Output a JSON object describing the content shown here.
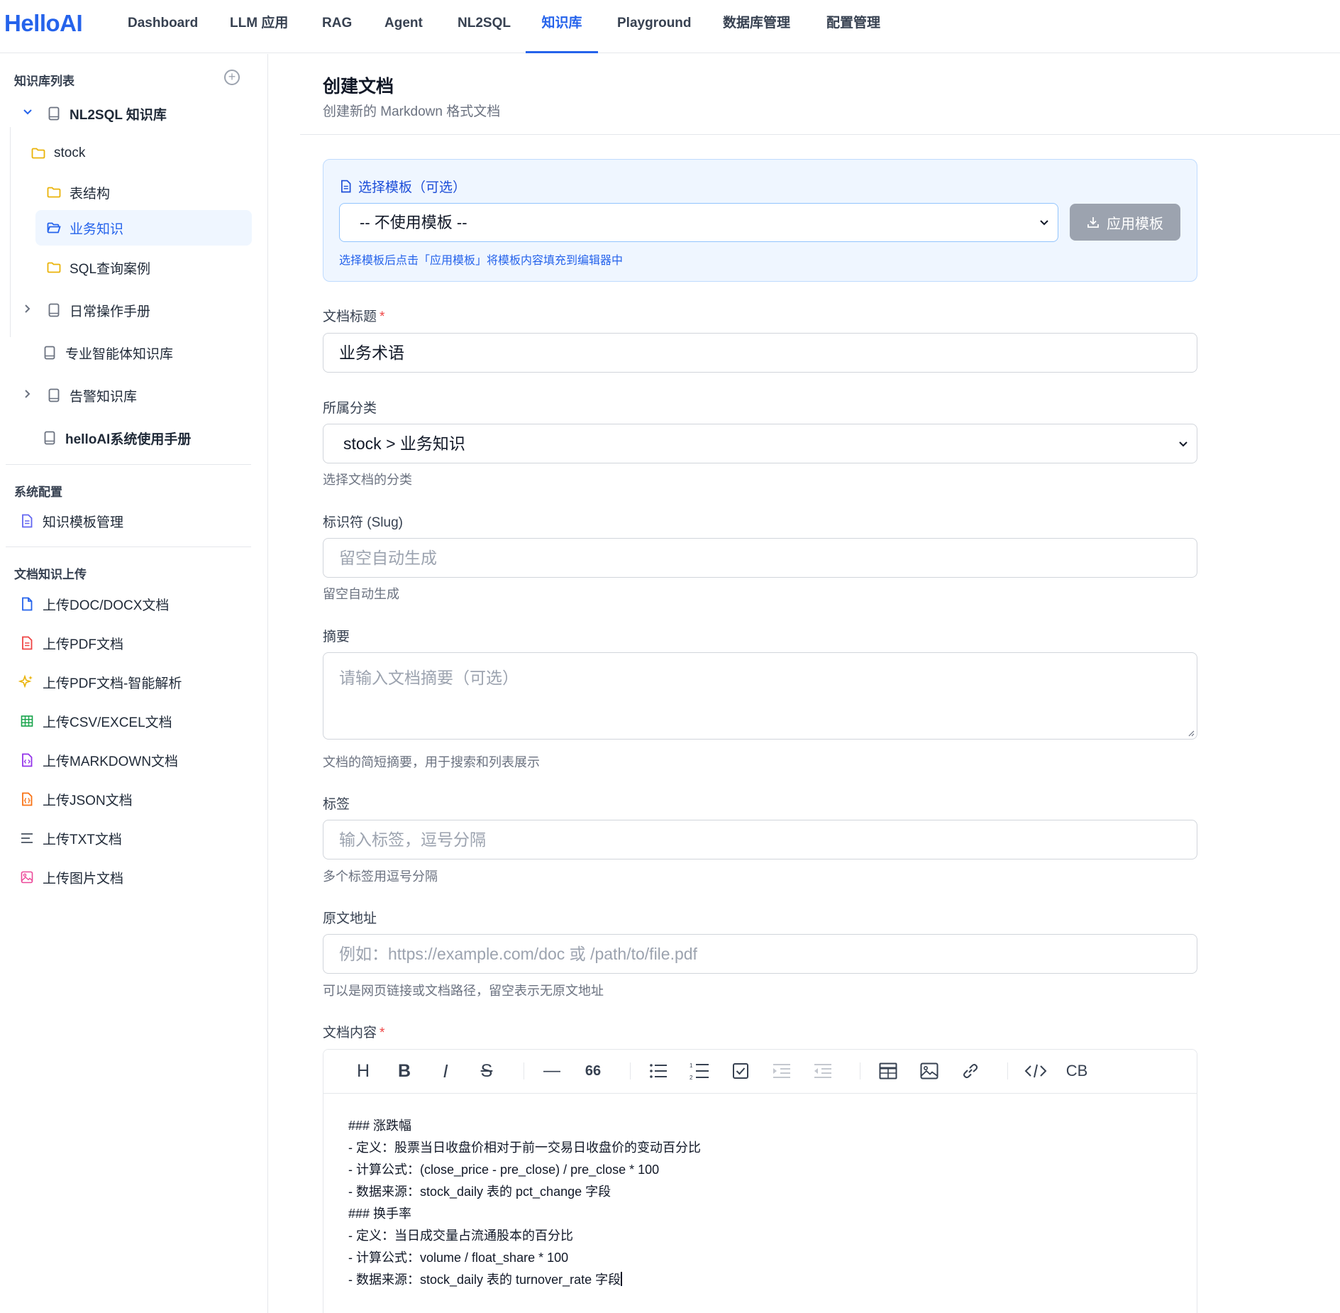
{
  "app": {
    "logo": "HelloAI"
  },
  "nav": {
    "items": [
      {
        "label": "Dashboard"
      },
      {
        "label": "LLM 应用"
      },
      {
        "label": "RAG"
      },
      {
        "label": "Agent"
      },
      {
        "label": "NL2SQL"
      },
      {
        "label": "知识库",
        "active": true
      },
      {
        "label": "Playground"
      },
      {
        "label": "数据库管理"
      },
      {
        "label": "配置管理"
      }
    ]
  },
  "sidebar": {
    "kb_title": "知识库列表",
    "kb_tree": [
      {
        "label": "NL2SQL 知识库",
        "expanded": true
      },
      {
        "label": "stock"
      },
      {
        "label": "表结构"
      },
      {
        "label": "业务知识",
        "selected": true
      },
      {
        "label": "SQL查询案例"
      },
      {
        "label": "日常操作手册"
      },
      {
        "label": "专业智能体知识库"
      },
      {
        "label": "告警知识库"
      },
      {
        "label": "helloAI系统使用手册"
      }
    ],
    "sys_title": "系统配置",
    "sys_items": [
      {
        "label": "知识模板管理",
        "icon": "document-icon"
      }
    ],
    "upload_title": "文档知识上传",
    "upload_items": [
      {
        "label": "上传DOC/DOCX文档",
        "icon": "file-icon",
        "color": "#2563eb"
      },
      {
        "label": "上传PDF文档",
        "icon": "pdf-icon",
        "color": "#ef4444"
      },
      {
        "label": "上传PDF文档-智能解析",
        "icon": "sparkles-icon",
        "color": "#eab308"
      },
      {
        "label": "上传CSV/EXCEL文档",
        "icon": "table-icon",
        "color": "#16a34a"
      },
      {
        "label": "上传MARKDOWN文档",
        "icon": "code-file-icon",
        "color": "#9333ea"
      },
      {
        "label": "上传JSON文档",
        "icon": "json-file-icon",
        "color": "#f97316"
      },
      {
        "label": "上传TXT文档",
        "icon": "text-lines-icon",
        "color": "#4b5563"
      },
      {
        "label": "上传图片文档",
        "icon": "image-icon",
        "color": "#ec4899"
      }
    ]
  },
  "main": {
    "title": "创建文档",
    "subtitle": "创建新的 Markdown 格式文档",
    "template": {
      "label": "选择模板（可选）",
      "selected": "-- 不使用模板 --",
      "apply_label": "应用模板",
      "hint": "选择模板后点击「应用模板」将模板内容填充到编辑器中"
    },
    "title_field": {
      "label": "文档标题",
      "value": "业务术语"
    },
    "category_field": {
      "label": "所属分类",
      "value": "stock > 业务知识",
      "help": "选择文档的分类"
    },
    "slug_field": {
      "label": "标识符 (Slug)",
      "placeholder": "留空自动生成",
      "help": "留空自动生成"
    },
    "summary_field": {
      "label": "摘要",
      "placeholder": "请输入文档摘要（可选）",
      "help": "文档的简短摘要，用于搜索和列表展示"
    },
    "tags_field": {
      "label": "标签",
      "placeholder": "输入标签，逗号分隔",
      "help": "多个标签用逗号分隔"
    },
    "source_field": {
      "label": "原文地址",
      "placeholder": "例如：https://example.com/doc 或 /path/to/file.pdf",
      "help": "可以是网页链接或文档路径，留空表示无原文地址"
    },
    "content_field": {
      "label": "文档内容",
      "toolbar": [
        "H",
        "B",
        "I",
        "S",
        "—",
        "66",
        "CB"
      ],
      "lines": [
        "### 涨跌幅",
        "- 定义：股票当日收盘价相对于前一交易日收盘价的变动百分比",
        "- 计算公式：(close_price - pre_close) / pre_close * 100",
        "- 数据来源：stock_daily 表的 pct_change 字段",
        "### 换手率",
        "- 定义：当日成交量占流通股本的百分比",
        "- 计算公式：volume / float_share * 100",
        "- 数据来源：stock_daily 表的 turnover_rate 字段"
      ]
    }
  }
}
